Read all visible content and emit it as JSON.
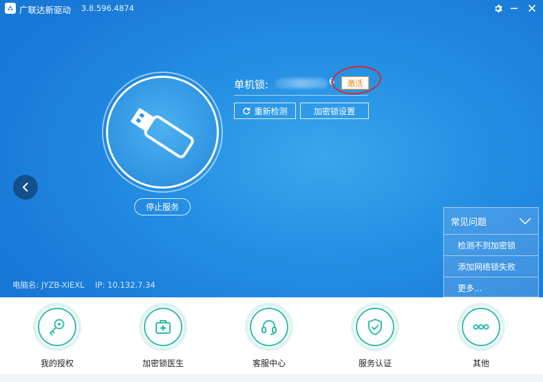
{
  "app": {
    "title": "广联达新驱动",
    "version": "3.8.596.4874"
  },
  "window_buttons": {
    "settings_icon": "gear-icon",
    "minimize_icon": "minimize-icon",
    "close_icon": "close-icon"
  },
  "device": {
    "lock_label": "单机锁:",
    "lock_value_visible_tail": "6",
    "activate_label": "激活",
    "redetect_label": "重新检测",
    "lock_settings_label": "加密锁设置",
    "stop_service_label": "停止服务"
  },
  "computer_info": {
    "name_label": "电脑名: JYZB-XIEXL",
    "ip_label": "IP: 10.132.7.34"
  },
  "faq": {
    "title": "常见问题",
    "items": [
      "检测不到加密锁",
      "添加网络锁失败",
      "更多..."
    ]
  },
  "features": [
    {
      "label": "我的授权",
      "icon": "key-icon"
    },
    {
      "label": "加密锁医生",
      "icon": "medical-kit-icon"
    },
    {
      "label": "客服中心",
      "icon": "headset-icon"
    },
    {
      "label": "服务认证",
      "icon": "shield-check-icon"
    },
    {
      "label": "其他",
      "icon": "more-icon"
    }
  ],
  "colors": {
    "primary_blue": "#248fe4",
    "accent_teal": "#2fbba8",
    "activate_orange": "#ef7d16",
    "highlight_red": "#d8262f"
  }
}
